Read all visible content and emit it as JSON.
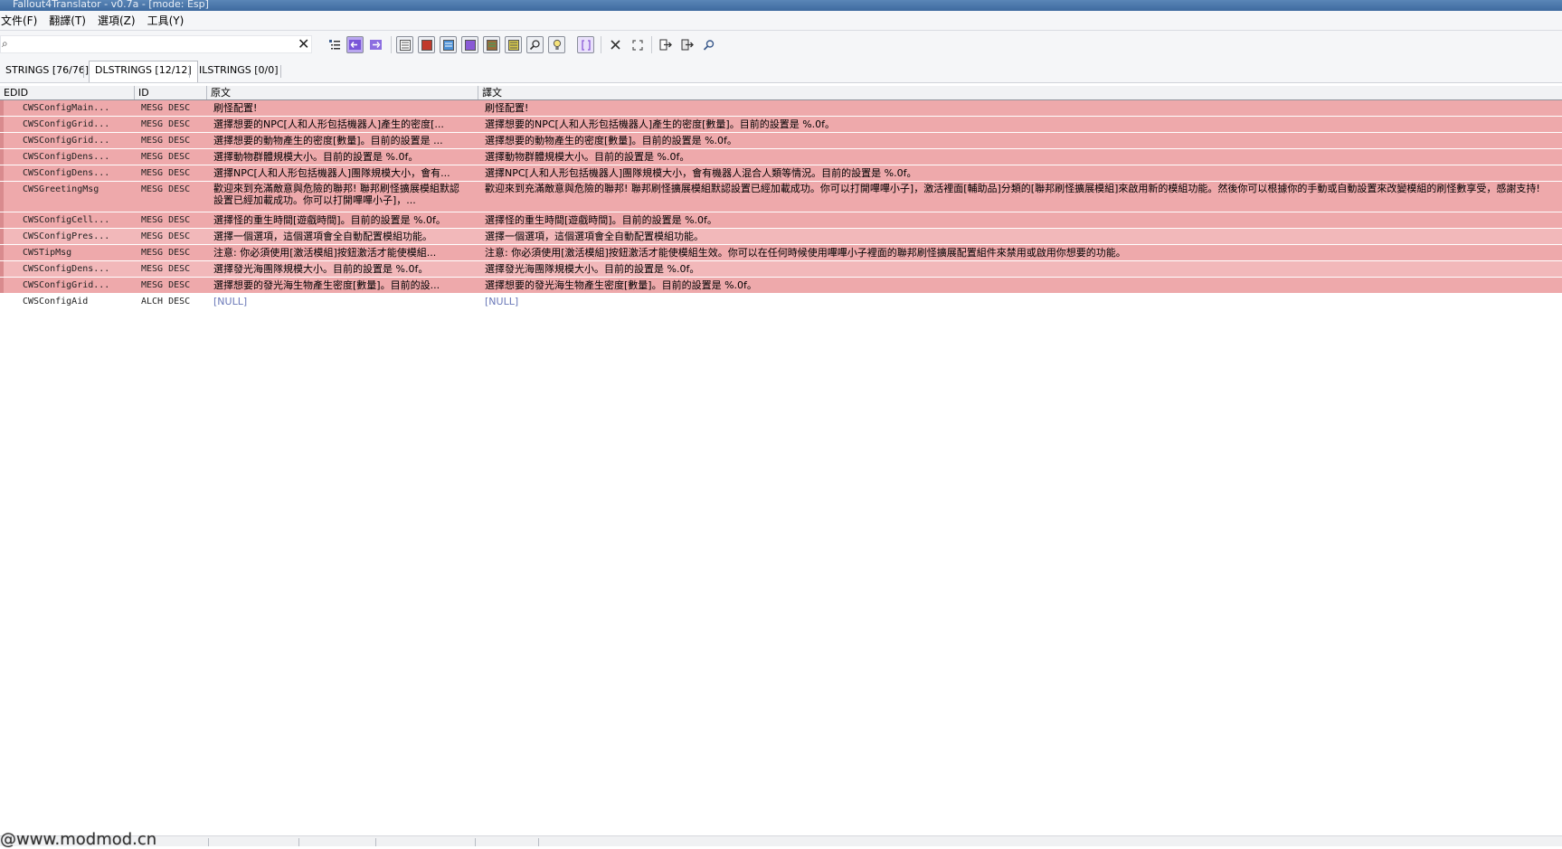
{
  "window": {
    "title": "Fallout4Translator - v0.7a - [mode: Esp]"
  },
  "menu": [
    "文件(F)",
    "翻譯(T)",
    "選項(Z)",
    "工具(Y)"
  ],
  "search": {
    "value": "",
    "placeholder": ""
  },
  "toolbar": {
    "buttons": [
      {
        "name": "tree-view-icon"
      },
      {
        "name": "prev-icon"
      },
      {
        "name": "next-icon"
      },
      {
        "name": "filter-all-icon"
      },
      {
        "name": "filter-red-icon"
      },
      {
        "name": "filter-blue-icon"
      },
      {
        "name": "filter-purple-icon"
      },
      {
        "name": "filter-brown-icon"
      },
      {
        "name": "filter-yellow-icon"
      },
      {
        "name": "find-icon"
      },
      {
        "name": "hint-icon"
      },
      {
        "name": "bracket-icon"
      },
      {
        "name": "close-icon"
      },
      {
        "name": "fullscreen-icon"
      },
      {
        "name": "export-icon"
      },
      {
        "name": "import-icon"
      },
      {
        "name": "search-user-icon"
      }
    ],
    "colors": {
      "red": "#c0392b",
      "blue": "#4a8fd6",
      "purple": "#8a5ad6",
      "brown": "#9a6b3a",
      "yellow": "#d8c94a"
    }
  },
  "tabs": [
    {
      "label": "STRINGS [76/76]",
      "active": false
    },
    {
      "label": "DLSTRINGS [12/12]",
      "active": true
    },
    {
      "label": "ILSTRINGS [0/0]",
      "active": false
    }
  ],
  "columns": [
    "EDID",
    "ID",
    "原文",
    "譯文"
  ],
  "rows": [
    {
      "edid": "CWSConfigMain...",
      "id": "MESG DESC",
      "orig": "刷怪配置!",
      "trans": "刷怪配置!",
      "style": "pink"
    },
    {
      "edid": "CWSConfigGrid...",
      "id": "MESG DESC",
      "orig": "選擇想要的NPC[人和人形包括機器人]產生的密度[...",
      "trans": "選擇想要的NPC[人和人形包括機器人]產生的密度[數量]。目前的設置是 %.0f。",
      "style": "pink"
    },
    {
      "edid": "CWSConfigGrid...",
      "id": "MESG DESC",
      "orig": "選擇想要的動物產生的密度[數量]。目前的設置是 ...",
      "trans": "選擇想要的動物產生的密度[數量]。目前的設置是 %.0f。",
      "style": "pink"
    },
    {
      "edid": "CWSConfigDens...",
      "id": "MESG DESC",
      "orig": "選擇動物群體規模大小。目前的設置是 %.0f。",
      "trans": "選擇動物群體規模大小。目前的設置是 %.0f。",
      "style": "pink"
    },
    {
      "edid": "CWSConfigDens...",
      "id": "MESG DESC",
      "orig": "選擇NPC[人和人形包括機器人]團隊規模大小，會有...",
      "trans": "選擇NPC[人和人形包括機器人]團隊規模大小，會有機器人混合人類等情況。目前的設置是 %.0f。",
      "style": "pink"
    },
    {
      "edid": "CWSGreetingMsg",
      "id": "MESG DESC",
      "orig": "歡迎來到充滿敵意與危險的聯邦! 聯邦刷怪擴展模組默認設置已經加載成功。你可以打開嗶嗶小子]，...",
      "trans": "歡迎來到充滿敵意與危險的聯邦! 聯邦刷怪擴展模組默認設置已經加載成功。你可以打開嗶嗶小子]，激活裡面[輔助品]分類的[聯邦刷怪擴展模組]來啟用新的模組功能。然後你可以根據你的手動或自動設置來改變模組的刷怪數享受，感謝支持!",
      "style": "pink",
      "tall": true
    },
    {
      "edid": "CWSConfigCell...",
      "id": "MESG DESC",
      "orig": "選擇怪的重生時間[遊戲時間]。目前的設置是 %.0f。",
      "trans": "選擇怪的重生時間[遊戲時間]。目前的設置是 %.0f。",
      "style": "pink"
    },
    {
      "edid": "CWSConfigPres...",
      "id": "MESG DESC",
      "orig": "選擇一個選項，這個選項會全自動配置模組功能。",
      "trans": "選擇一個選項，這個選項會全自動配置模組功能。",
      "style": "pink-l"
    },
    {
      "edid": "CWSTipMsg",
      "id": "MESG DESC",
      "orig": "注意: 你必須使用[激活模組]按鈕激活才能使模組...",
      "trans": "注意: 你必須使用[激活模組]按鈕激活才能使模組生效。你可以在任何時候使用嗶嗶小子裡面的聯邦刷怪擴展配置組件來禁用或啟用你想要的功能。",
      "style": "pink"
    },
    {
      "edid": "CWSConfigDens...",
      "id": "MESG DESC",
      "orig": "選擇發光海團隊規模大小。目前的設置是 %.0f。",
      "trans": "選擇發光海團隊規模大小。目前的設置是 %.0f。",
      "style": "pink-l"
    },
    {
      "edid": "CWSConfigGrid...",
      "id": "MESG DESC",
      "orig": "選擇想要的發光海生物產生密度[數量]。目前的設...",
      "trans": "選擇想要的發光海生物產生密度[數量]。目前的設置是 %.0f。",
      "style": "pink"
    },
    {
      "edid": "CWSConfigAid",
      "id": "ALCH DESC",
      "orig": "[NULL]",
      "trans": "[NULL]",
      "style": "white",
      "null": true
    }
  ],
  "watermark": "@www.modmod.cn"
}
